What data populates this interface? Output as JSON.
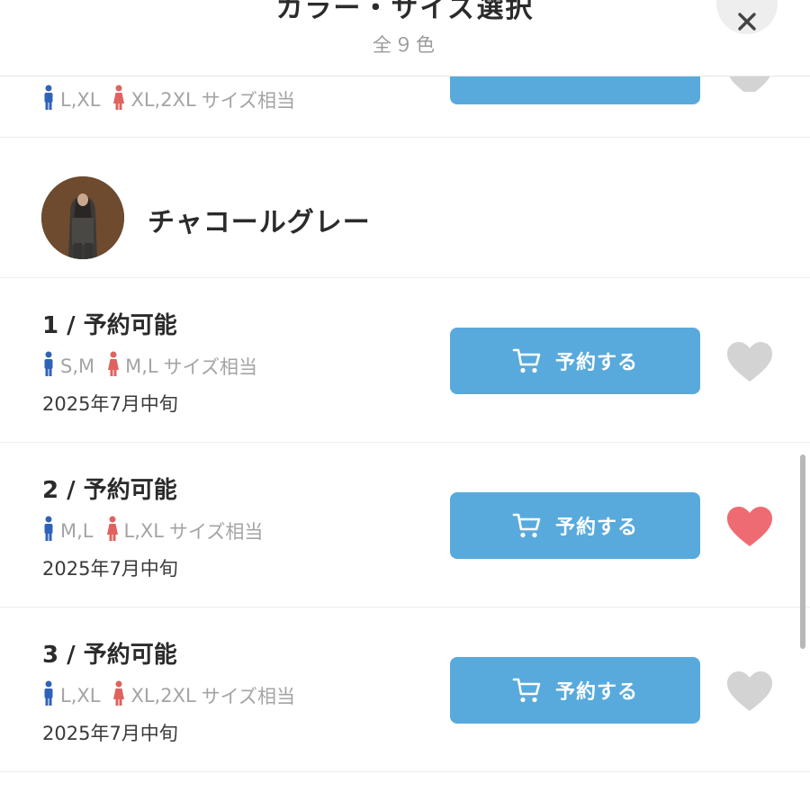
{
  "header": {
    "title": "カラー・サイズ選択",
    "subtitle": "全９色",
    "close_label": "×"
  },
  "prev_row": {
    "male_sizes": "L,XL",
    "female_sizes": "XL,2XL",
    "size_suffix": "サイズ相当"
  },
  "color": {
    "name": "チャコールグレー"
  },
  "rows": [
    {
      "number": "1 /",
      "status": "予約可能",
      "male_sizes": "S,M",
      "female_sizes": "M,L",
      "size_suffix": "サイズ相当",
      "date": "2025年7月中旬",
      "button_label": "予約する",
      "favorited": false
    },
    {
      "number": "2 /",
      "status": "予約可能",
      "male_sizes": "M,L",
      "female_sizes": "L,XL",
      "size_suffix": "サイズ相当",
      "date": "2025年7月中旬",
      "button_label": "予約する",
      "favorited": true
    },
    {
      "number": "3 /",
      "status": "予約可能",
      "male_sizes": "L,XL",
      "female_sizes": "XL,2XL",
      "size_suffix": "サイズ相当",
      "date": "2025年7月中旬",
      "button_label": "予約する",
      "favorited": false
    }
  ],
  "colors": {
    "accent_button": "#58aadc",
    "heart_active": "#ef6b73",
    "heart_inactive": "#d3d3d3",
    "male_icon": "#2f63b8",
    "female_icon": "#e0625f"
  },
  "icons": {
    "close": "close-icon",
    "cart": "cart-icon",
    "heart": "heart-icon",
    "male": "male-person-icon",
    "female": "female-person-icon"
  }
}
